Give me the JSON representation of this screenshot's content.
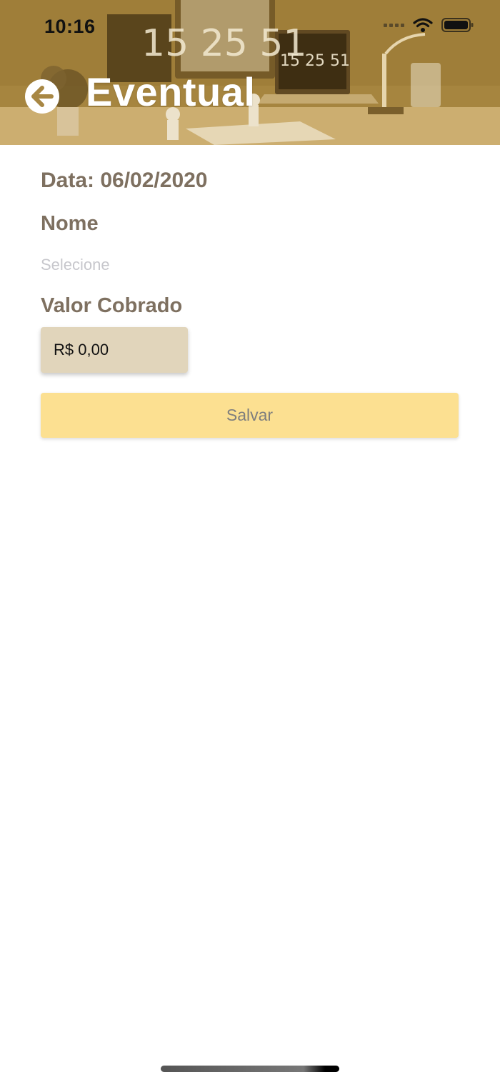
{
  "status_bar": {
    "time": "10:16"
  },
  "header": {
    "title": "Eventual",
    "back_icon": "arrow-left-circle-icon",
    "photo_clock_text_large": "15 25 51",
    "photo_clock_text_small": "15 25 51"
  },
  "form": {
    "date_line": "Data: 06/02/2020",
    "name_label": "Nome",
    "name_placeholder": "Selecione",
    "valor_label": "Valor Cobrado",
    "valor_value": "R$ 0,00",
    "save_label": "Salvar"
  },
  "colors": {
    "header_tint": "#a88744",
    "label_text": "#7e7060",
    "input_bg": "#e1d5bb",
    "button_bg": "#fce091",
    "button_text": "#7e7e7e",
    "placeholder_text": "#c7c7cc"
  }
}
